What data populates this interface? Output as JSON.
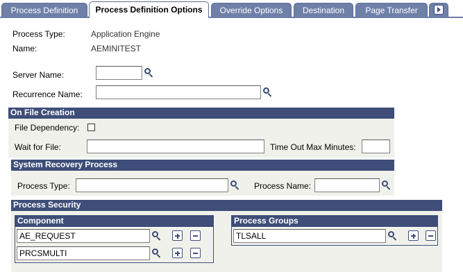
{
  "tabs": [
    {
      "label": "Process Definition",
      "active": false
    },
    {
      "label": "Process Definition Options",
      "active": true
    },
    {
      "label": "Override Options",
      "active": false
    },
    {
      "label": "Destination",
      "active": false
    },
    {
      "label": "Page Transfer",
      "active": false
    }
  ],
  "header": {
    "process_type_label": "Process Type:",
    "process_type_value": "Application Engine",
    "name_label": "Name:",
    "name_value": "AEMINITEST"
  },
  "fields": {
    "server_name_label": "Server Name:",
    "server_name_value": "",
    "recurrence_name_label": "Recurrence Name:",
    "recurrence_name_value": ""
  },
  "on_file_creation": {
    "title": "On File Creation",
    "file_dependency_label": "File Dependency:",
    "file_dependency_checked": false,
    "wait_for_file_label": "Wait for File:",
    "wait_for_file_value": "",
    "timeout_label": "Time Out Max Minutes:",
    "timeout_value": ""
  },
  "system_recovery": {
    "title": "System Recovery Process",
    "process_type_label": "Process Type:",
    "process_type_value": "",
    "process_name_label": "Process Name:",
    "process_name_value": ""
  },
  "process_security": {
    "title": "Process Security",
    "component": {
      "header": "Component",
      "rows": [
        "AE_REQUEST",
        "PRCSMULTI"
      ]
    },
    "process_groups": {
      "header": "Process Groups",
      "rows": [
        "TLSALL"
      ]
    }
  },
  "colors": {
    "tab_inactive": "#6f80a8",
    "header_bar": "#3e4e78",
    "section_bg": "#f1f1ec",
    "value_text": "#333333"
  },
  "icons": {
    "lookup": "magnifier-icon",
    "add_row": "plus-icon",
    "delete_row": "minus-icon",
    "tab_scroll": "right-arrow-icon"
  }
}
